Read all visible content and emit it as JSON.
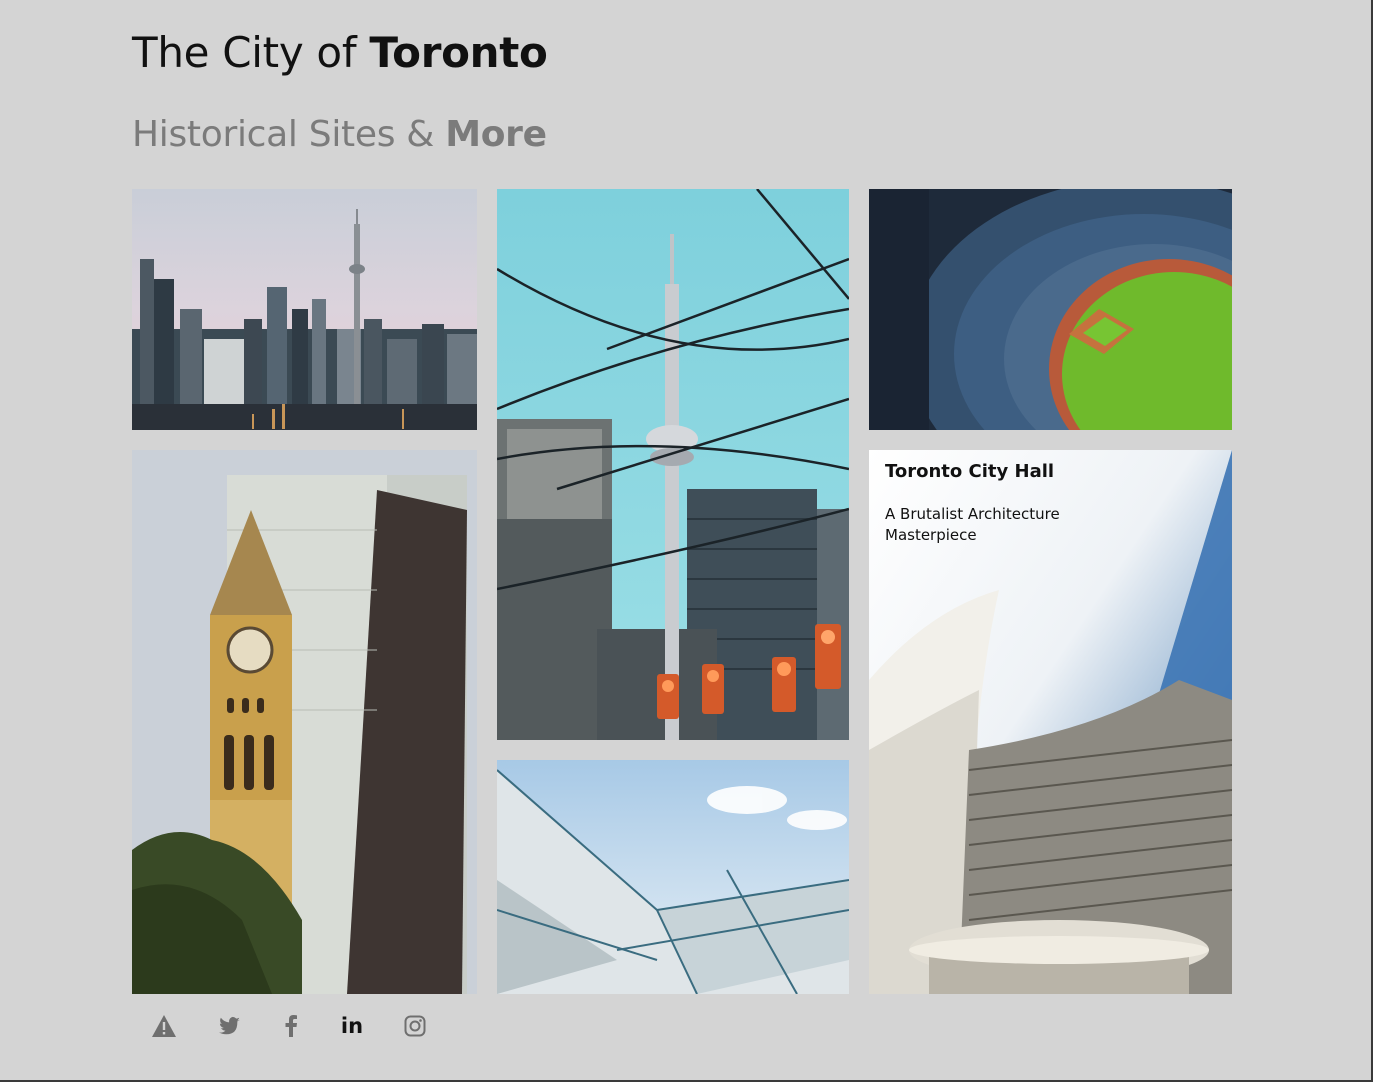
{
  "header": {
    "title_prefix": "The City of ",
    "title_bold": "Toronto",
    "subtitle_prefix": "Historical Sites & ",
    "subtitle_bold": "More"
  },
  "gallery": {
    "featured": {
      "title": "Toronto City Hall",
      "subtitle": "A Brutalist Architecture Masterpiece"
    }
  },
  "social": {
    "icons": [
      "warning-icon",
      "twitter-icon",
      "facebook-icon",
      "linkedin-icon",
      "instagram-icon"
    ],
    "linkedin_label": "in"
  },
  "colors": {
    "background": "#d4d4d4",
    "heading": "#111111",
    "subheading": "#7b7b7b",
    "icon": "#6f6f6f",
    "icon_active": "#111111"
  }
}
